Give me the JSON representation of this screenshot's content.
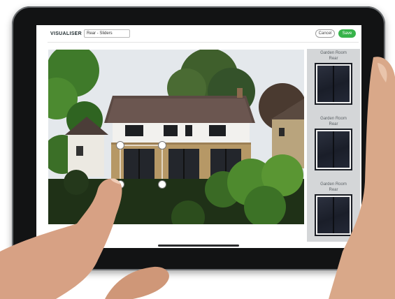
{
  "app": {
    "title": "VISUALISER",
    "design_name": "Rear - Sliders",
    "cancel_label": "Cancel",
    "save_label": "Save",
    "accent_color": "#37b34a"
  },
  "options": [
    {
      "label_line1": "Garden Room",
      "label_line2": "Rear"
    },
    {
      "label_line1": "Garden Room",
      "label_line2": "Rear"
    },
    {
      "label_line1": "Garden Room",
      "label_line2": "Rear"
    }
  ],
  "photo": {
    "handles": 4
  }
}
